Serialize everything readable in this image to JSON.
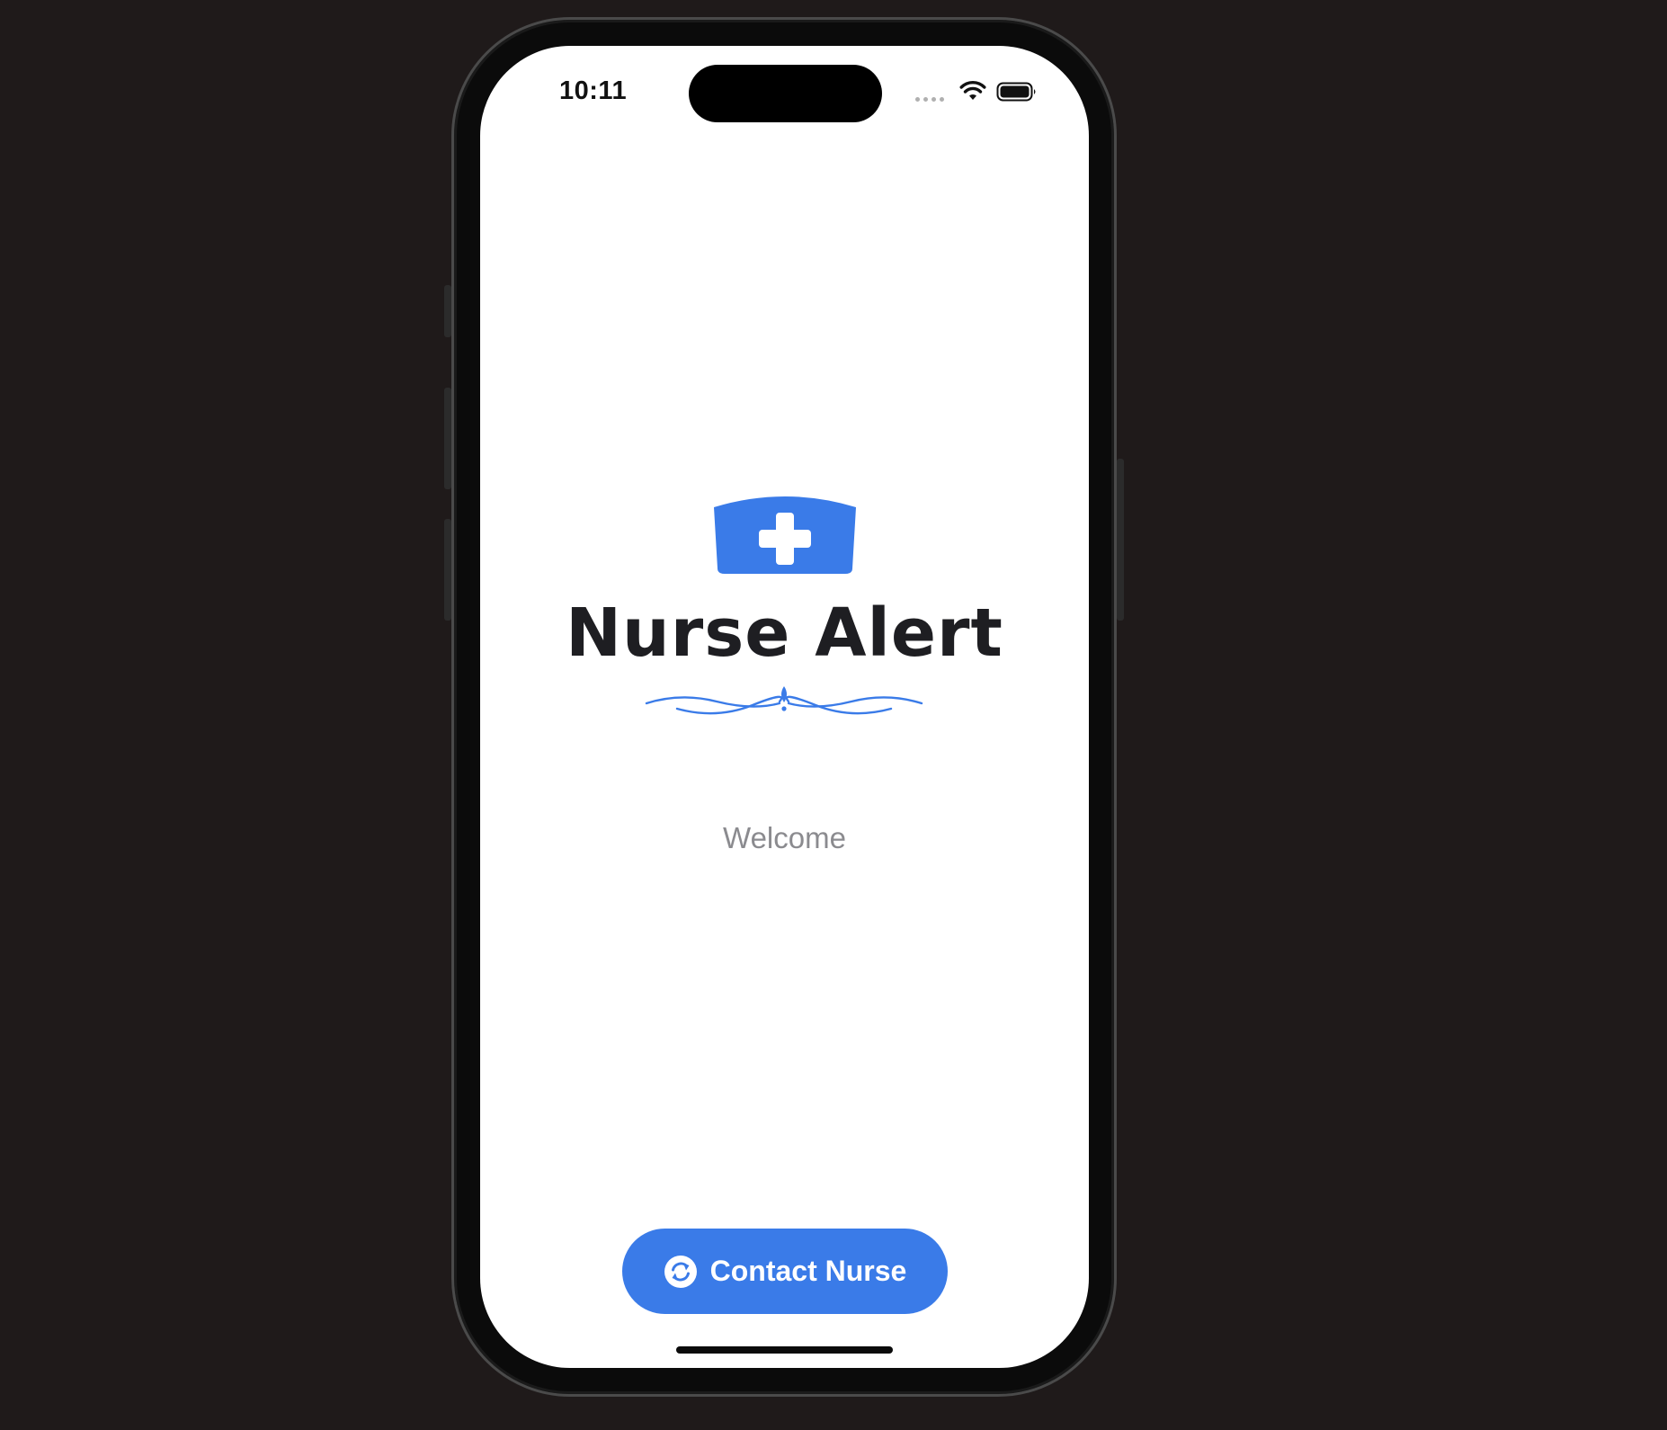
{
  "status_bar": {
    "time": "10:11",
    "wifi_icon": "wifi-icon",
    "battery_icon": "battery-icon"
  },
  "app": {
    "logo_icon": "nurse-cap-icon",
    "title": "Nurse Alert",
    "welcome_text": "Welcome",
    "brand_color": "#3a7be8"
  },
  "actions": {
    "contact_label": "Contact Nurse",
    "contact_icon": "refresh-arrows-icon"
  }
}
